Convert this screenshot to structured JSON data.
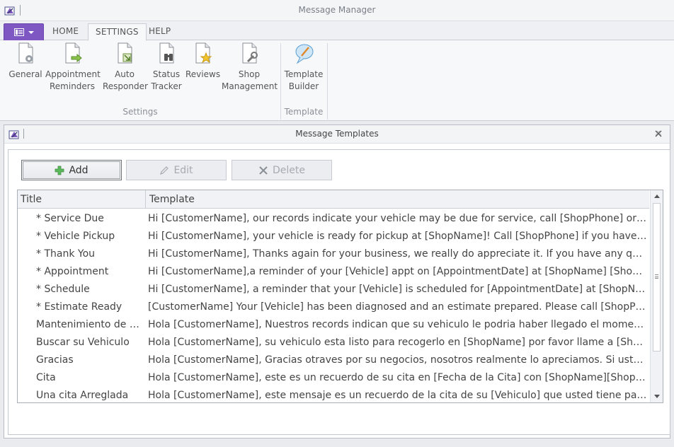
{
  "window": {
    "title": "Message Manager"
  },
  "tabs": [
    {
      "label": "HOME"
    },
    {
      "label": "SETTINGS"
    },
    {
      "label": "HELP"
    }
  ],
  "ribbon": {
    "buttons": [
      {
        "label": "General",
        "label2": "",
        "icon": "gear-document-icon"
      },
      {
        "label": "Appointment",
        "label2": "Reminders",
        "icon": "arrow-document-icon"
      },
      {
        "label": "Auto",
        "label2": "Responder",
        "icon": "reply-document-icon"
      },
      {
        "label": "Status",
        "label2": "Tracker",
        "icon": "binoculars-document-icon"
      },
      {
        "label": "Reviews",
        "label2": "",
        "icon": "star-document-icon"
      },
      {
        "label": "Shop",
        "label2": "Management",
        "icon": "wrench-document-icon"
      },
      {
        "label": "Template",
        "label2": "Builder",
        "icon": "speech-bubble-icon"
      }
    ],
    "groups": [
      {
        "label": "Settings"
      },
      {
        "label": "Template"
      }
    ]
  },
  "dialog": {
    "title": "Message Templates",
    "add_label": "Add",
    "edit_label": "Edit",
    "delete_label": "Delete"
  },
  "grid": {
    "columns": [
      "Title",
      "Template"
    ],
    "rows": [
      {
        "title": "* Service Due",
        "template": "Hi [CustomerName], our records indicate your vehicle may be due for service, call [ShopPhone] or reply to this message to schedule."
      },
      {
        "title": "* Vehicle Pickup",
        "template": "Hi [CustomerName], your vehicle is ready for pickup at [ShopName]! Call [ShopPhone] if you have any questions."
      },
      {
        "title": "* Thank You",
        "template": "Hi [CustomerName], Thanks again for your business, we really do appreciate it. If you have any questions please call us."
      },
      {
        "title": "* Appointment",
        "template": "Hi [CustomerName],a reminder of your [Vehicle] appt on [AppointmentDate] at [ShopName] [ShopPhone]"
      },
      {
        "title": "* Schedule",
        "template": "Hi [CustomerName], a reminder that your [Vehicle] is scheduled for [AppointmentDate] at [ShopName] [ShopPhone]"
      },
      {
        "title": "* Estimate Ready",
        "template": "[CustomerName] Your [Vehicle] has been diagnosed and an estimate prepared. Please call [ShopPhone] to review."
      },
      {
        "title": "Mantenimiento de el vehiculo",
        "template": "Hola [CustomerName], Nuestros records indican que su vehiculo le podria haber llegado el momento de servicio."
      },
      {
        "title": "Buscar su Vehiculo",
        "template": "Hola [CustomerName], su vehiculo esta listo para recogerlo en [ShopName] por favor llame a [ShopPhone]"
      },
      {
        "title": "Gracias",
        "template": "Hola [CustomerName], Gracias otraves por su negocios, nosotros realmente lo apreciamos. Si usted tiene preguntas llame."
      },
      {
        "title": "Cita",
        "template": "Hola [CustomerName], este es un recuerdo de su cita en [Fecha de la Cita] con [ShopName][ShopPhone]"
      },
      {
        "title": "Una cita Arreglada",
        "template": "Hola [CustomerName], este mensaje es un recuerdo de la cita de su [Vehiculo] que usted tiene para [AppointmentDate]"
      }
    ]
  },
  "colors": {
    "accent_purple": "#7e57c2",
    "add_icon_green": "#5cb85c"
  }
}
